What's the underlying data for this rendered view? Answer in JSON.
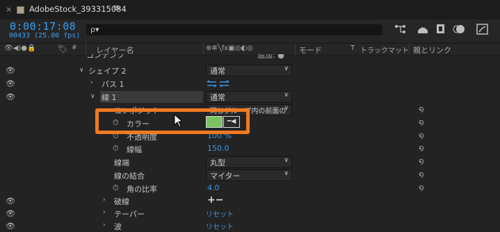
{
  "tab": {
    "close": "×",
    "title": "AdobeStock_393315084",
    "menu": "≡"
  },
  "time": {
    "timecode": "0:00:17:08",
    "frames": "00433 (25.00 fps)"
  },
  "search": {
    "icon": "ρ▾",
    "value": ""
  },
  "columns": {
    "av_switches": "👁◀)●🔒",
    "tag": "🏷",
    "number": "#",
    "layer_name": "レイヤー名",
    "switches": "⊕✲╲fx▣◎◐◎",
    "mode": "モード",
    "t": "T",
    "track_matte": "トラックマット",
    "parent_link": "親とリンク"
  },
  "rows": [
    {
      "label": "コンテンツ",
      "extra": "追加: ●"
    },
    {
      "label": "シェイプ 2",
      "value": "通常"
    },
    {
      "label": "パス 1"
    },
    {
      "label": "線 1",
      "value": "通常"
    },
    {
      "label": "コンポジット",
      "value": "同じグループ内の前面の"
    },
    {
      "label": "カラー"
    },
    {
      "label": "不透明度",
      "value": "100 %"
    },
    {
      "label": "線幅",
      "value": "150.0"
    },
    {
      "label": "線端",
      "value": "丸型"
    },
    {
      "label": "線の結合",
      "value": "マイター"
    },
    {
      "label": "角の比率",
      "value": "4.0"
    },
    {
      "label": "破線",
      "value": "+−"
    },
    {
      "label": "テーパー",
      "value": "リセット"
    },
    {
      "label": "波",
      "value": "リセット"
    }
  ],
  "colors": {
    "accent": "#3aa0f2",
    "highlight": "#f07a1f",
    "stroke_color": "#7ac360",
    "bg": "#232323"
  }
}
